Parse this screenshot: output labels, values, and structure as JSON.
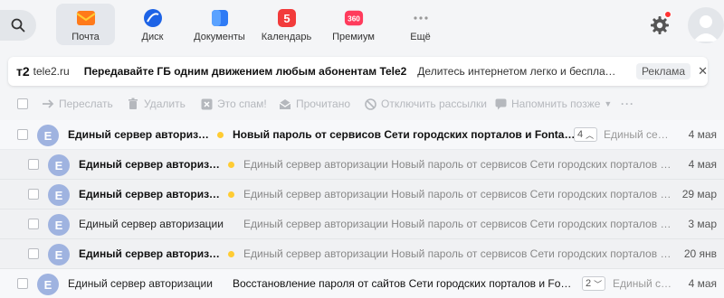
{
  "services": [
    {
      "label": "Почта",
      "icon": "mail-icon",
      "active": true
    },
    {
      "label": "Диск",
      "icon": "disk-icon",
      "active": false
    },
    {
      "label": "Документы",
      "icon": "documents-icon",
      "active": false
    },
    {
      "label": "Календарь",
      "icon": "calendar-icon",
      "badge": "5",
      "active": false
    },
    {
      "label": "Премиум",
      "icon": "premium-icon",
      "badge": "360",
      "active": false
    },
    {
      "label": "Ещё",
      "icon": "more-icon",
      "active": false
    }
  ],
  "ad": {
    "logo": "т2",
    "site": "tele2.ru",
    "title": "Передавайте ГБ одним движением любым абонентам Tele2",
    "desc": "Делитесь интернетом легко и бесплатно с абонентами",
    "tag": "Реклама",
    "close": "✕"
  },
  "toolbar": {
    "forward": "Переслать",
    "delete": "Удалить",
    "spam": "Это спам!",
    "read": "Прочитано",
    "unsubscribe": "Отключить рассылки",
    "remind": "Напомнить позже",
    "more": "···"
  },
  "messages": [
    {
      "kind": "thread",
      "avatar": "Е",
      "from": "Единый сервер авторизации",
      "unread": true,
      "subject": "Новый пароль от сервисов Сети городских порталов и Fontanka.ru",
      "count": "4",
      "snippet": "Единый сервер авторизации",
      "date": "4 мая"
    },
    {
      "kind": "child",
      "avatar": "Е",
      "from": "Единый сервер авторизации",
      "unread": true,
      "subject": "Единый сервер авторизации Новый пароль от сервисов Сети городских порталов и Fontanka.ru",
      "date": "4 мая"
    },
    {
      "kind": "child",
      "avatar": "Е",
      "from": "Единый сервер авторизации",
      "unread": true,
      "subject": "Единый сервер авторизации Новый пароль от сервисов Сети городских порталов и Fontanka.ru",
      "date": "29 мар"
    },
    {
      "kind": "child",
      "avatar": "Е",
      "from": "Единый сервер авторизации",
      "unread": false,
      "subject": "Единый сервер авторизации Новый пароль от сервисов Сети городских порталов и Fontanka.ru",
      "date": "3 мар"
    },
    {
      "kind": "child",
      "avatar": "Е",
      "from": "Единый сервер авторизации",
      "unread": true,
      "subject": "Единый сервер авторизации Новый пароль от сервисов Сети городских порталов и Fontanka.ru",
      "date": "20 янв"
    },
    {
      "kind": "thread",
      "avatar": "Е",
      "from": "Единый сервер авторизации",
      "unread": false,
      "subject": "Восстановление пароля от сайтов Сети городских порталов и Fontanka.ru",
      "count": "2",
      "snippet": "Единый сервер авторизации",
      "date": "4 мая"
    }
  ]
}
